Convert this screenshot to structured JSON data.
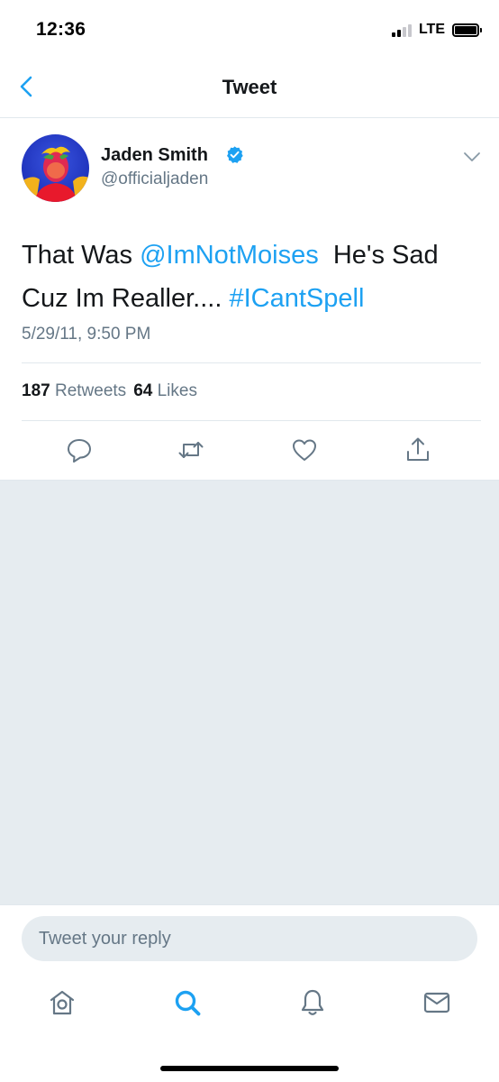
{
  "status_bar": {
    "time": "12:36",
    "network": "LTE"
  },
  "nav": {
    "title": "Tweet"
  },
  "tweet": {
    "author_name": "Jaden Smith",
    "author_handle": "@officialjaden",
    "text_parts": {
      "p1": "That Was ",
      "mention": "@ImNotMoises",
      "p2": "  He's Sad Cuz Im Realler.... ",
      "hashtag": "#ICantSpell"
    },
    "timestamp": "5/29/11, 9:50 PM",
    "retweet_count": "187",
    "retweet_label": "Retweets",
    "like_count": "64",
    "like_label": "Likes"
  },
  "reply": {
    "placeholder": "Tweet your reply"
  },
  "icons": [
    "back-icon",
    "verified-icon",
    "chevron-down-icon",
    "reply-icon",
    "retweet-icon",
    "like-icon",
    "share-icon",
    "home-icon",
    "search-icon",
    "notifications-icon",
    "messages-icon"
  ],
  "colors": {
    "accent": "#1da1f2",
    "text": "#14171a",
    "secondary": "#657786",
    "background": "#e6ecf0"
  }
}
